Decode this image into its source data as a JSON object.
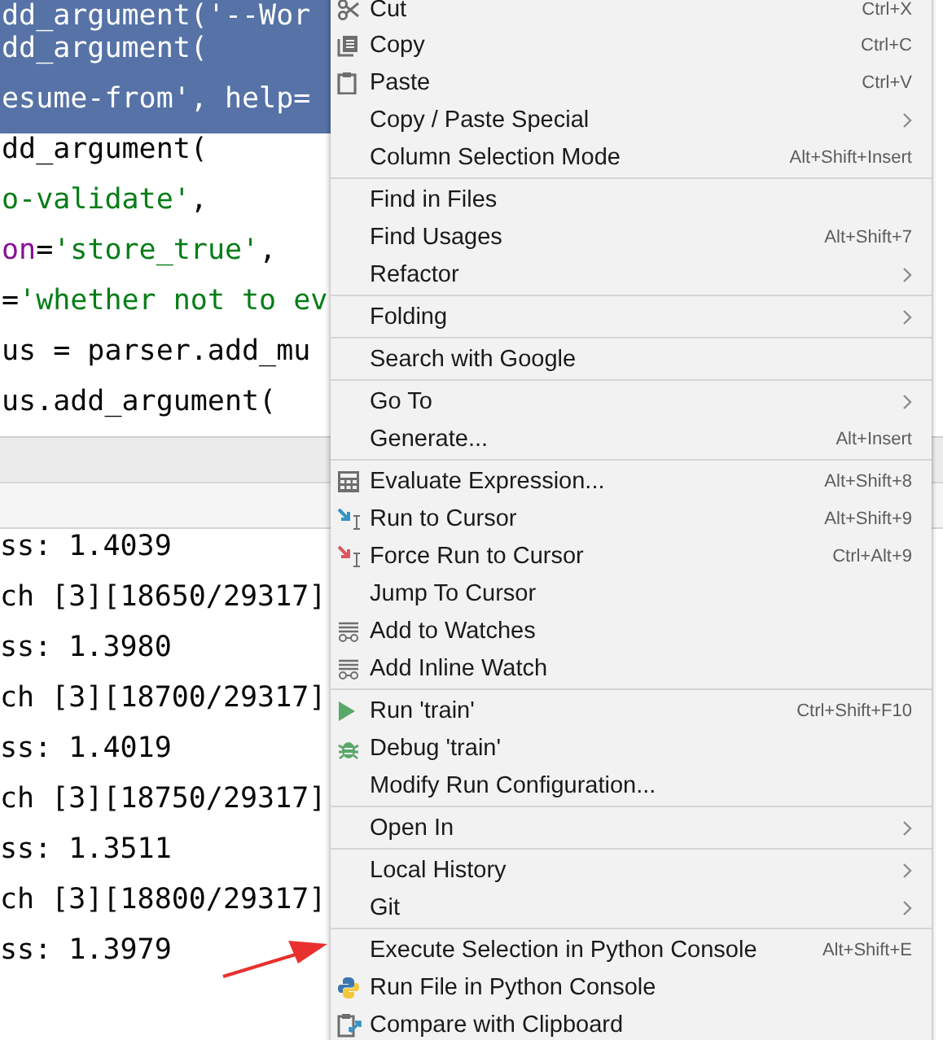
{
  "editor": {
    "lines": [
      {
        "selected": true,
        "segments": [
          {
            "text": "dd_argument(",
            "kind": "plain"
          },
          {
            "text": "'--Wor",
            "kind": "string"
          }
        ]
      },
      {
        "selected": true,
        "segments": [
          {
            "text": "dd_argument(",
            "kind": "plain"
          }
        ]
      },
      {
        "selected": true,
        "segments": [
          {
            "text": "esume-from'",
            "kind": "string"
          },
          {
            "text": ", help=",
            "kind": "plain"
          }
        ]
      },
      {
        "selected": false,
        "segments": [
          {
            "text": "dd_argument(",
            "kind": "plain"
          }
        ]
      },
      {
        "selected": false,
        "segments": [
          {
            "text": "o-validate'",
            "kind": "string"
          },
          {
            "text": ",",
            "kind": "plain"
          }
        ]
      },
      {
        "selected": false,
        "segments": [
          {
            "text": "on",
            "kind": "keyword"
          },
          {
            "text": "=",
            "kind": "plain"
          },
          {
            "text": "'store_true'",
            "kind": "string"
          },
          {
            "text": ",",
            "kind": "plain"
          }
        ]
      },
      {
        "selected": false,
        "segments": [
          {
            "text": "=",
            "kind": "plain"
          },
          {
            "text": "'whether not to ev",
            "kind": "string"
          }
        ]
      },
      {
        "selected": false,
        "segments": [
          {
            "text": "us = parser.add_mu",
            "kind": "plain"
          }
        ]
      },
      {
        "selected": false,
        "segments": [
          {
            "text": "us.add_argument(",
            "kind": "plain"
          }
        ]
      }
    ]
  },
  "console": {
    "lines": [
      "ss: 1.4039",
      "ch [3][18650/29317]",
      "ss: 1.3980",
      "ch [3][18700/29317]",
      "ss: 1.4019",
      "ch [3][18750/29317]",
      "ss: 1.3511",
      "ch [3][18800/29317]",
      "ss: 1.3979"
    ]
  },
  "context_menu": {
    "sections": [
      [
        {
          "label": "Cut",
          "shortcut": "Ctrl+X",
          "submenu": false
        },
        {
          "label": "Copy",
          "shortcut": "Ctrl+C",
          "submenu": false
        },
        {
          "label": "Paste",
          "shortcut": "Ctrl+V",
          "submenu": false
        },
        {
          "label": "Copy / Paste Special",
          "submenu": true
        },
        {
          "label": "Column Selection Mode",
          "shortcut": "Alt+Shift+Insert",
          "submenu": false
        }
      ],
      [
        {
          "label": "Find in Files",
          "submenu": false
        },
        {
          "label": "Find Usages",
          "shortcut": "Alt+Shift+7",
          "submenu": false
        },
        {
          "label": "Refactor",
          "submenu": true
        }
      ],
      [
        {
          "label": "Folding",
          "submenu": true
        }
      ],
      [
        {
          "label": "Search with Google",
          "submenu": false
        }
      ],
      [
        {
          "label": "Go To",
          "submenu": true
        },
        {
          "label": "Generate...",
          "shortcut": "Alt+Insert",
          "submenu": false
        }
      ],
      [
        {
          "label": "Evaluate Expression...",
          "shortcut": "Alt+Shift+8",
          "submenu": false
        },
        {
          "label": "Run to Cursor",
          "shortcut": "Alt+Shift+9",
          "submenu": false
        },
        {
          "label": "Force Run to Cursor",
          "shortcut": "Ctrl+Alt+9",
          "submenu": false
        },
        {
          "label": "Jump To Cursor",
          "submenu": false
        },
        {
          "label": "Add to Watches",
          "submenu": false
        },
        {
          "label": "Add Inline Watch",
          "submenu": false
        }
      ],
      [
        {
          "label": "Run 'train'",
          "shortcut": "Ctrl+Shift+F10",
          "submenu": false
        },
        {
          "label": "Debug 'train'",
          "submenu": false
        },
        {
          "label": "Modify Run Configuration...",
          "submenu": false
        }
      ],
      [
        {
          "label": "Open In",
          "submenu": true
        }
      ],
      [
        {
          "label": "Local History",
          "submenu": true
        },
        {
          "label": "Git",
          "submenu": true
        }
      ],
      [
        {
          "label": "Execute Selection in Python Console",
          "shortcut": "Alt+Shift+E",
          "submenu": false
        },
        {
          "label": "Run File in Python Console",
          "submenu": false
        },
        {
          "label": "Compare with Clipboard",
          "submenu": false
        }
      ]
    ]
  }
}
